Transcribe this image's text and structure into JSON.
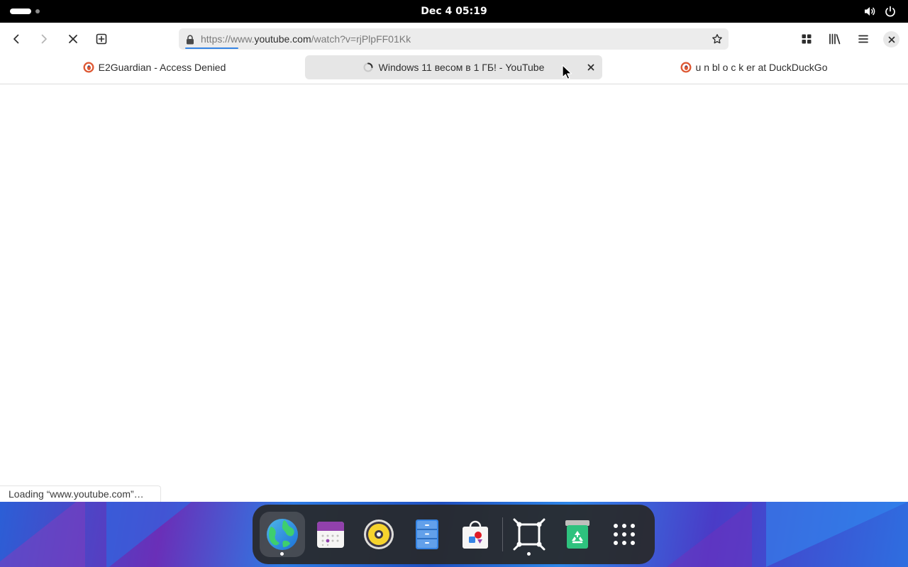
{
  "topbar": {
    "clock": "Dec 4  05:19",
    "icons": [
      "activities-workspace-indicator",
      "volume-icon",
      "power-icon"
    ]
  },
  "browser": {
    "nav": [
      "back-icon",
      "forward-icon",
      "stop-icon",
      "new-tab-icon"
    ],
    "url": {
      "prefix": "https://www.",
      "host": "youtube.com",
      "path": "/watch?v=rjPlpFF01Kk"
    },
    "header_icons": [
      "tab-overview-icon",
      "library-icon",
      "menu-icon",
      "close-icon"
    ]
  },
  "tabs": [
    {
      "title": "E2Guardian - Access Denied",
      "favicon": "duckduckgo-icon",
      "active": false
    },
    {
      "title": "Windows 11 весом в 1 ГБ! - YouTube",
      "favicon": "loading-spinner-icon",
      "active": true
    },
    {
      "title": "u n bl o c k er at DuckDuckGo",
      "favicon": "duckduckgo-icon",
      "active": false
    }
  ],
  "status": "Loading “www.youtube.com”…",
  "dock": {
    "apps": [
      {
        "name": "web-browser",
        "running": true
      },
      {
        "name": "calendar",
        "running": false
      },
      {
        "name": "rhythmbox-music",
        "running": false
      },
      {
        "name": "files",
        "running": false
      },
      {
        "name": "software",
        "running": false
      },
      {
        "name": "screenshot-tool",
        "running": true
      },
      {
        "name": "trash",
        "running": false
      },
      {
        "name": "show-apps",
        "running": false
      }
    ]
  },
  "colors": {
    "accent": "#3584e4",
    "topbar_bg": "#000000",
    "urlbar_bg": "#ececec",
    "active_tab_bg": "#e6e6e6"
  }
}
